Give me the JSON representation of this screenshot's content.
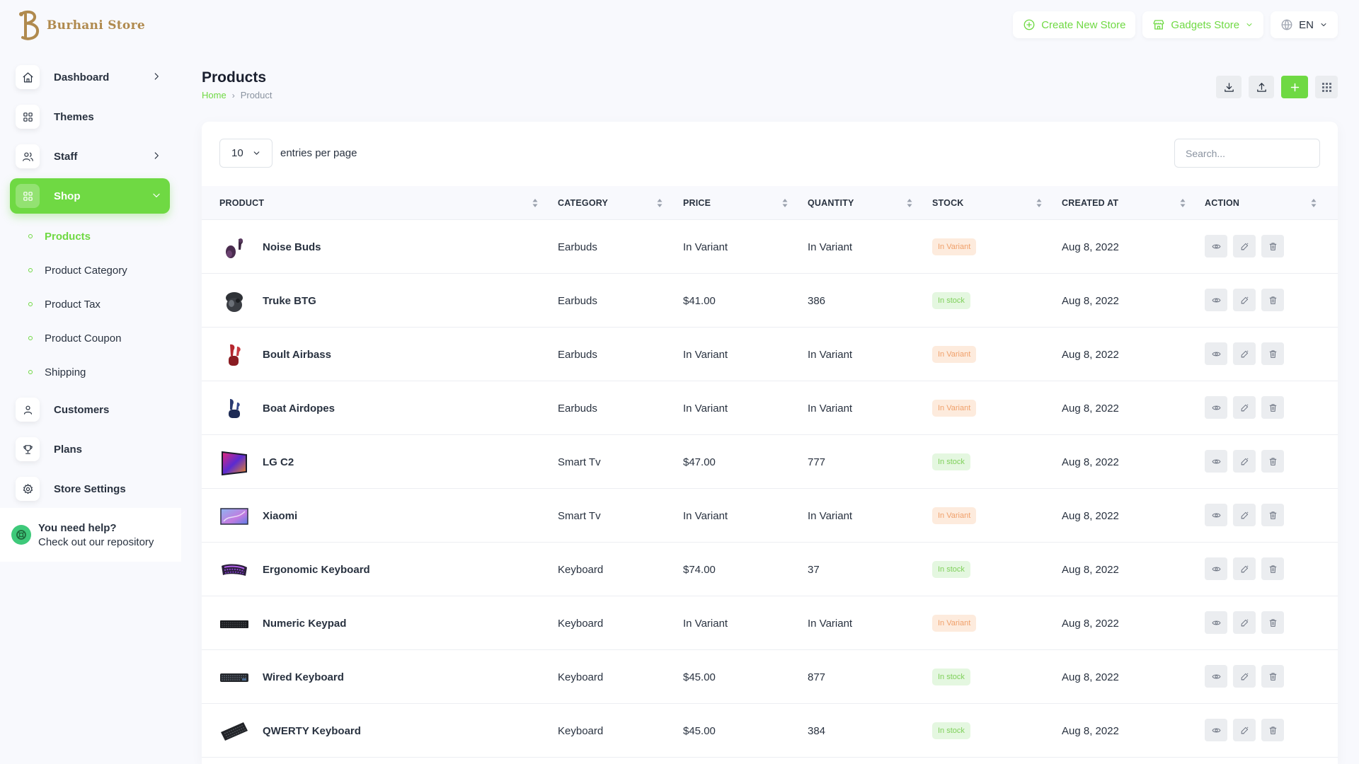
{
  "brand": {
    "name": "Burhani Store",
    "logo_icon": "store-logo-icon"
  },
  "header": {
    "create_store_label": "Create New Store",
    "store_selector_label": "Gadgets Store",
    "language_label": "EN",
    "accent_color": "#6fd943"
  },
  "sidebar": {
    "items": [
      {
        "label": "Dashboard",
        "icon": "home-icon"
      },
      {
        "label": "Themes",
        "icon": "grid-icon"
      },
      {
        "label": "Staff",
        "icon": "users-icon"
      },
      {
        "label": "Shop",
        "icon": "grid-icon"
      },
      {
        "label": "Customers",
        "icon": "user-icon"
      },
      {
        "label": "Plans",
        "icon": "trophy-icon"
      },
      {
        "label": "Store Settings",
        "icon": "gear-icon"
      }
    ],
    "shop_sub": [
      {
        "label": "Products"
      },
      {
        "label": "Product Category"
      },
      {
        "label": "Product Tax"
      },
      {
        "label": "Product Coupon"
      },
      {
        "label": "Shipping"
      }
    ],
    "help": {
      "title": "You need help?",
      "subtitle": "Check out our repository"
    }
  },
  "page": {
    "title": "Products",
    "breadcrumb": {
      "home": "Home",
      "current": "Product"
    }
  },
  "table": {
    "per_page_value": "10",
    "per_page_label": "entries per page",
    "search_placeholder": "Search...",
    "columns": [
      "PRODUCT",
      "CATEGORY",
      "PRICE",
      "QUANTITY",
      "STOCK",
      "CREATED AT",
      "ACTION"
    ],
    "rows": [
      {
        "name": "Noise Buds",
        "category": "Earbuds",
        "price": "In Variant",
        "quantity": "In Variant",
        "stock": "In Variant",
        "created": "Aug 8, 2022",
        "thumb": "earbuds-purple"
      },
      {
        "name": "Truke BTG",
        "category": "Earbuds",
        "price": "$41.00",
        "quantity": "386",
        "stock": "In stock",
        "created": "Aug 8, 2022",
        "thumb": "earbuds-black"
      },
      {
        "name": "Boult Airbass",
        "category": "Earbuds",
        "price": "In Variant",
        "quantity": "In Variant",
        "stock": "In Variant",
        "created": "Aug 8, 2022",
        "thumb": "earbuds-red"
      },
      {
        "name": "Boat Airdopes",
        "category": "Earbuds",
        "price": "In Variant",
        "quantity": "In Variant",
        "stock": "In Variant",
        "created": "Aug 8, 2022",
        "thumb": "earbuds-blue"
      },
      {
        "name": "LG C2",
        "category": "Smart Tv",
        "price": "$47.00",
        "quantity": "777",
        "stock": "In stock",
        "created": "Aug 8, 2022",
        "thumb": "tv-colorful"
      },
      {
        "name": "Xiaomi",
        "category": "Smart Tv",
        "price": "In Variant",
        "quantity": "In Variant",
        "stock": "In Variant",
        "created": "Aug 8, 2022",
        "thumb": "tv-blue"
      },
      {
        "name": "Ergonomic Keyboard",
        "category": "Keyboard",
        "price": "$74.00",
        "quantity": "37",
        "stock": "In stock",
        "created": "Aug 8, 2022",
        "thumb": "keyboard-purple"
      },
      {
        "name": "Numeric Keypad",
        "category": "Keyboard",
        "price": "In Variant",
        "quantity": "In Variant",
        "stock": "In Variant",
        "created": "Aug 8, 2022",
        "thumb": "keyboard-black"
      },
      {
        "name": "Wired Keyboard",
        "category": "Keyboard",
        "price": "$45.00",
        "quantity": "877",
        "stock": "In stock",
        "created": "Aug 8, 2022",
        "thumb": "keyboard-dark"
      },
      {
        "name": "QWERTY Keyboard",
        "category": "Keyboard",
        "price": "$45.00",
        "quantity": "384",
        "stock": "In stock",
        "created": "Aug 8, 2022",
        "thumb": "keyboard-angled"
      }
    ]
  },
  "colors": {
    "variant_badge_bg": "#fdebdd",
    "variant_badge_text": "#f0a06a",
    "stock_badge_bg": "#e4f7e0",
    "stock_badge_text": "#7fd05a"
  }
}
